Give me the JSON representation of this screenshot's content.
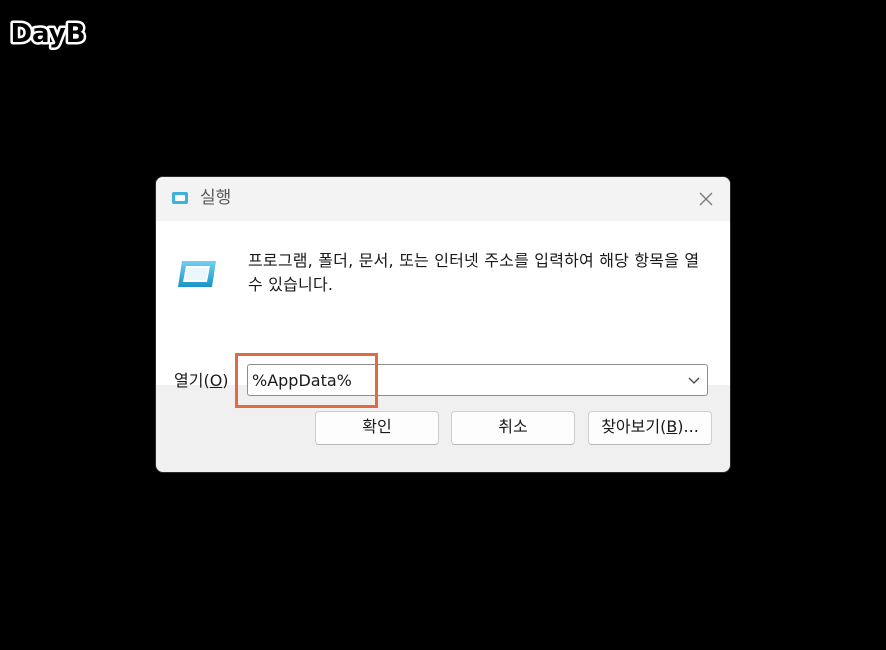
{
  "watermark": {
    "text": "DayB"
  },
  "dialog": {
    "title": "실행",
    "description": "프로그램, 폴더, 문서, 또는 인터넷 주소를 입력하여 해당 항목을 열 수 있습니다.",
    "open_label": "열기(",
    "open_label_key": "O",
    "open_label_end": ")",
    "input_value": "%AppData%",
    "buttons": {
      "ok": "확인",
      "cancel": "취소",
      "browse_prefix": "찾아보기(",
      "browse_key": "B",
      "browse_suffix": ")..."
    }
  },
  "icons": {
    "title": "run-app-icon",
    "main": "run-app-icon",
    "close": "close-icon",
    "dropdown": "chevron-down-icon"
  },
  "colors": {
    "highlight": "#e26a3f",
    "icon_blue": "#2aa8d8"
  }
}
